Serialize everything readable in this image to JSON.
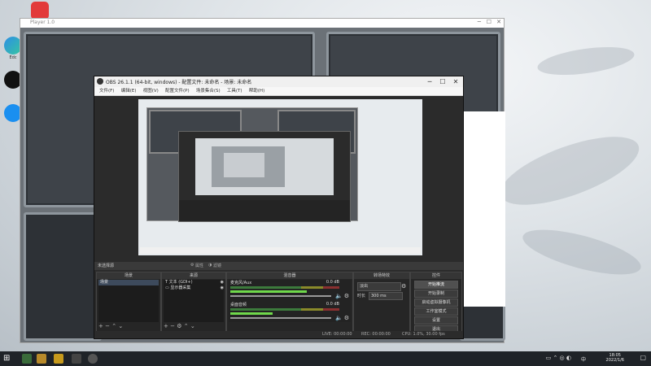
{
  "desktop": {
    "icons": [
      {
        "name": "netease-music",
        "label": ""
      },
      {
        "name": "edge",
        "label": "Microsoft Edge"
      },
      {
        "name": "qq",
        "label": "QQ"
      },
      {
        "name": "kugou",
        "label": "Kugou"
      }
    ],
    "edge_label_partial": "Edc",
    "bg_window_title": "Player 1.0"
  },
  "obs": {
    "title": "OBS 26.1.1 (64-bit, windows) - 配置文件: 未命名 - 场景: 未命名",
    "menu": [
      "文件(F)",
      "编辑(E)",
      "视图(V)",
      "配置文件(P)",
      "场景集合(S)",
      "工具(T)",
      "帮助(H)"
    ],
    "status_label": "未选择源",
    "props_button": "属性",
    "filters_button": "滤镜",
    "docks": {
      "scenes": {
        "title": "场景",
        "items": [
          "场景"
        ]
      },
      "sources": {
        "title": "来源",
        "items": [
          "文本 (GDI+)",
          "显示器采集"
        ]
      },
      "mixer": {
        "title": "混音器",
        "tracks": [
          {
            "name": "麦克风/Aux",
            "db": "0.0 dB",
            "level": 0.72
          },
          {
            "name": "桌面音频",
            "db": "0.0 dB",
            "level": 0.4
          }
        ]
      },
      "transitions": {
        "title": "转场特效",
        "type": "淡出",
        "duration_label": "时长",
        "duration": "300 ms"
      },
      "controls": {
        "title": "控件",
        "buttons": [
          "开始推流",
          "开始录制",
          "启动虚拟摄像机",
          "工作室模式",
          "设置",
          "退出"
        ]
      }
    },
    "statusbar": {
      "live": "LIVE: 00:00:00",
      "rec": "REC: 00:00:00",
      "cpu": "CPU: 1.0%, 30.00 fps"
    }
  },
  "taskbar": {
    "time": "18:05",
    "date": "2022/1/6",
    "lang": "中"
  },
  "colors": {
    "obs_bg": "#2b2b2b",
    "accent_green": "#6fd84b",
    "taskbar": "#1f2328"
  }
}
